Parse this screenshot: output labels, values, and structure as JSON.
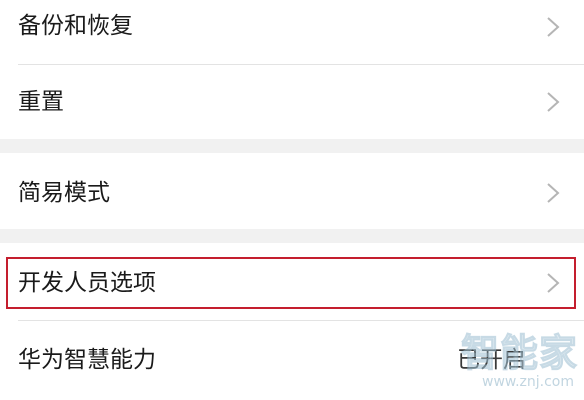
{
  "settings": {
    "items": [
      {
        "label": "备份和恢复"
      },
      {
        "label": "重置"
      },
      {
        "label": "简易模式"
      },
      {
        "label": "开发人员选项"
      },
      {
        "label": "华为智慧能力",
        "status": "已开启"
      }
    ]
  },
  "watermark": {
    "text": "智能家",
    "url": "www.znj.com"
  },
  "colors": {
    "background": "#ffffff",
    "section_gap": "#f1f1f1",
    "divider": "#e3e3e3",
    "text": "#1a1a1a",
    "chevron": "#b5b5b5",
    "highlight_border": "#c41e2e"
  },
  "icons": {
    "row_arrow": "chevron-right-icon"
  }
}
